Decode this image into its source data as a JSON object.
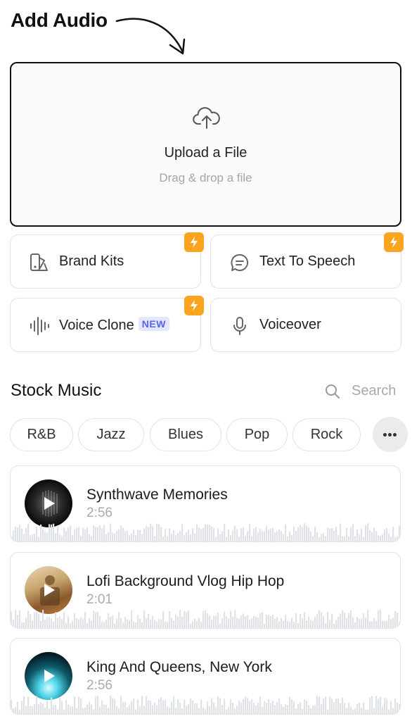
{
  "header": {
    "title": "Add Audio"
  },
  "upload": {
    "title": "Upload a File",
    "subtitle": "Drag & drop a file"
  },
  "tiles": [
    {
      "label": "Brand Kits",
      "icon": "brand-kit-icon",
      "premium": true
    },
    {
      "label": "Text To Speech",
      "icon": "speech-bubble-icon",
      "premium": true
    },
    {
      "label": "Voice Clone",
      "icon": "waveform-icon",
      "premium": true,
      "badge": "NEW"
    },
    {
      "label": "Voiceover",
      "icon": "microphone-icon",
      "premium": false
    }
  ],
  "stock": {
    "title": "Stock Music",
    "search_placeholder": "Search",
    "genres": [
      "R&B",
      "Jazz",
      "Blues",
      "Pop",
      "Rock"
    ],
    "more_icon": "ellipsis-icon"
  },
  "tracks": [
    {
      "name": "Synthwave Memories",
      "duration": "2:56"
    },
    {
      "name": "Lofi Background Vlog Hip Hop",
      "duration": "2:01"
    },
    {
      "name": "King And Queens, New York",
      "duration": "2:56"
    }
  ],
  "colors": {
    "accent_bolt": "#fba41f",
    "new_badge_bg": "#e3e7ff",
    "new_badge_text": "#5965f0",
    "waveform": "#dfe3e6"
  }
}
